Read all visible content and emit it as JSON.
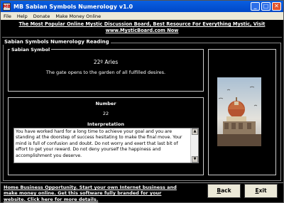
{
  "window": {
    "title": "MB Sabian Symbols Numerology v1.0",
    "app_icon": "MB"
  },
  "titlebar_buttons": {
    "minimize": "_",
    "maximize": "□",
    "close": "✕"
  },
  "menu": [
    "File",
    "Help",
    "Donate",
    "Make Money Online"
  ],
  "banner": {
    "line1": "The Most Popular Online Mystic Discussion Board, Best Resource For Everything Mystic, Visit",
    "line2": "www.MysticBoard.com Now"
  },
  "main": {
    "title": "Sabian Symbols Numerology Reading",
    "symbol_section": {
      "title": "Sabian Symbol",
      "name": "22º Aries",
      "description": "The gate opens to the garden of all fulfilled desires."
    },
    "number_section": {
      "label": "Number",
      "value": "22",
      "interpretation_label": "Interpretation",
      "interpretation": "You have worked hard for a long time to achieve your goal and you are standing at the doorstep of success hesitating to make the final move. Your mind is full of confusion and doubt. Do not worry and exert that last bit of effort to get your reward. Do not deny yourself the happiness and accomplishment you deserve."
    },
    "image": {
      "subject": "domed cathedral with birds"
    }
  },
  "footer": {
    "promo_line1": "Home Business Opportunity. Start your own Internet business and",
    "promo_line2": "make money online. Get this software fully branded for your",
    "promo_line3": "website. Click here for more details.",
    "back_prefix": "B",
    "back_rest": "ack",
    "exit_prefix": "E",
    "exit_rest": "xit"
  },
  "colors": {
    "background": "#000000",
    "titlebar": "#0a5fe0",
    "menubar": "#ece9d8",
    "text": "#ffffff"
  }
}
